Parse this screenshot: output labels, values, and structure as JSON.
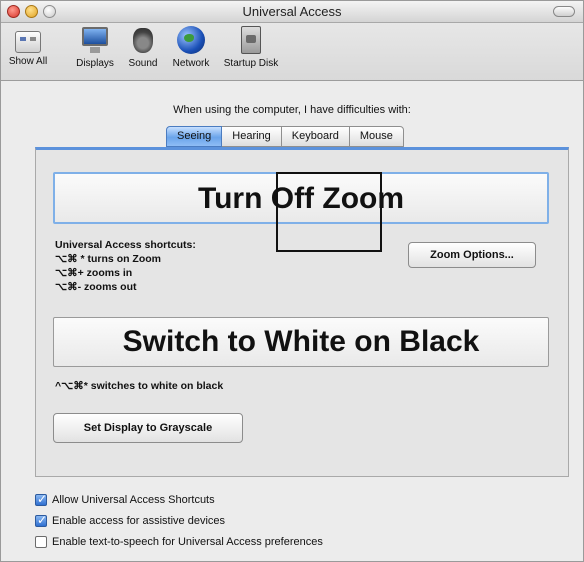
{
  "window": {
    "title": "Universal Access"
  },
  "toolbar": {
    "items": [
      {
        "label": "Show All",
        "icon": "show-all-icon"
      },
      {
        "label": "Displays",
        "icon": "displays-icon"
      },
      {
        "label": "Sound",
        "icon": "sound-icon"
      },
      {
        "label": "Network",
        "icon": "network-icon"
      },
      {
        "label": "Startup Disk",
        "icon": "startup-disk-icon"
      }
    ]
  },
  "header": {
    "subtitle": "When using the computer, I have difficulties with:"
  },
  "tabs": [
    {
      "label": "Seeing",
      "active": true
    },
    {
      "label": "Hearing",
      "active": false
    },
    {
      "label": "Keyboard",
      "active": false
    },
    {
      "label": "Mouse",
      "active": false
    }
  ],
  "seeing": {
    "zoom_button": "Turn Off Zoom",
    "shortcuts_title": "Universal Access shortcuts:",
    "shortcut_lines": [
      "⌥⌘ * turns on Zoom",
      "⌥⌘+ zooms in",
      "⌥⌘- zooms out"
    ],
    "zoom_options_button": "Zoom Options...",
    "contrast_button": "Switch to White on Black",
    "contrast_note": "^⌥⌘* switches to white on black",
    "grayscale_button": "Set Display to Grayscale"
  },
  "checkboxes": [
    {
      "label": "Allow Universal Access Shortcuts",
      "checked": true
    },
    {
      "label": "Enable access for assistive devices",
      "checked": true
    },
    {
      "label": "Enable text-to-speech for Universal Access preferences",
      "checked": false
    }
  ],
  "colors": {
    "accent": "#5c92dc",
    "active_tab": "#6aa4ea"
  }
}
